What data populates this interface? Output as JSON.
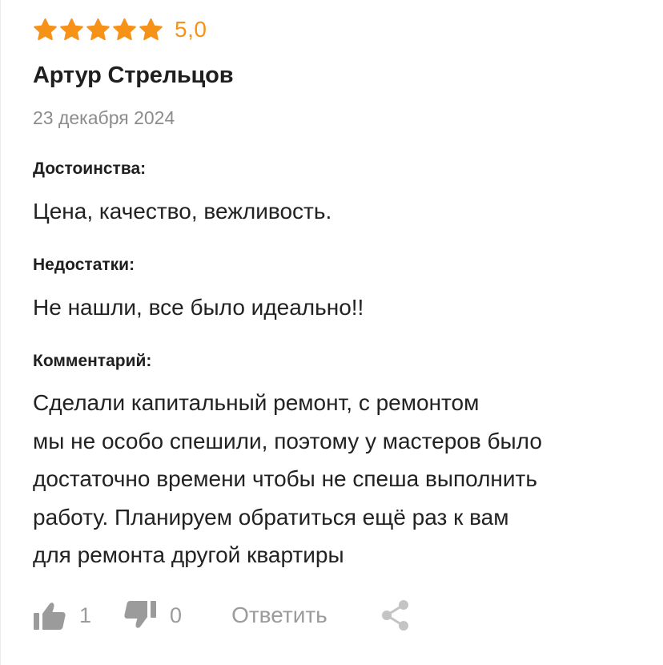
{
  "review": {
    "rating": {
      "stars": 5,
      "max_stars": 5,
      "value_text": "5,0",
      "star_color": "#f79219"
    },
    "author": "Артур Стрельцов",
    "date": "23 декабря 2024",
    "pros": {
      "label": "Достоинства:",
      "text": "Цена, качество, вежливость."
    },
    "cons": {
      "label": "Недостатки:",
      "text": "Не нашли, все было идеально!!"
    },
    "comment": {
      "label": "Комментарий:",
      "lines": [
        "Сделали капитальный ремонт, с ремонтом",
        "мы не особо спешили, поэтому у мастеров было",
        "достаточно времени чтобы не спеша выполнить",
        "работу. Планируем обратиться ещё раз к вам",
        "для ремонта другой квартиры"
      ]
    },
    "actions": {
      "like_icon": "thumbs-up-icon",
      "like_count": "1",
      "dislike_icon": "thumbs-down-icon",
      "dislike_count": "0",
      "reply_label": "Ответить",
      "share_icon": "share-icon"
    }
  },
  "colors": {
    "accent": "#f79219",
    "muted": "#9b9b9b",
    "text": "#222222"
  }
}
